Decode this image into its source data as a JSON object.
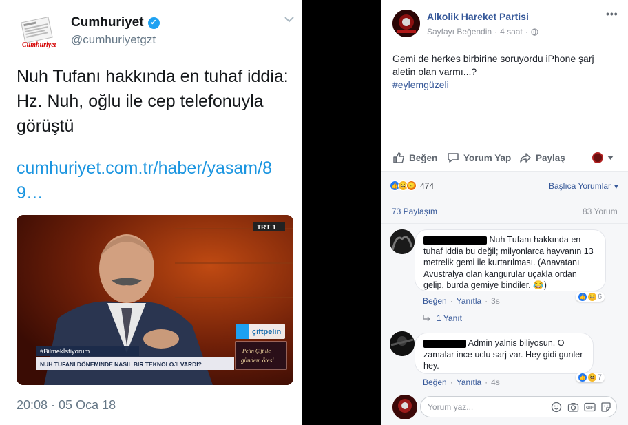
{
  "tweet": {
    "logo_text": "Cumhuriyet",
    "name": "Cumhuriyet",
    "handle": "@cumhuriyetgzt",
    "text": "Nuh Tufanı hakkında en tuhaf iddia: Hz. Nuh, oğlu ile cep telefonuyla görüştü",
    "link": "cumhuriyet.com.tr/haber/yasam/89…",
    "media": {
      "channel": "TRT 1",
      "hashtag": "#Bilmekİstiyorum",
      "twitter_handle": "çiftpelin",
      "lower_third": "NUH TUFANI DÖNEMINDE NASIL BIR TEKNOLOJI VARDI?",
      "program_logo_line1": "Pelin Çift ile",
      "program_logo_line2": "gündem ötesi"
    },
    "timestamp": "20:08 · 05 Oca 18"
  },
  "fb": {
    "page_name": "Alkolik Hareket Partisi",
    "meta_liked": "Sayfayı Beğendin",
    "meta_time": "4 saat",
    "post_text": "Gemi de herkes birbirine soruyordu iPhone şarj aletin olan varmı...?",
    "post_hashtag": "#eylemgüzeli",
    "actions": {
      "like": "Beğen",
      "comment": "Yorum Yap",
      "share": "Paylaş"
    },
    "reaction_count": "474",
    "relevance": "Başlıca Yorumlar",
    "shares": "73 Paylaşım",
    "comment_count": "83 Yorum",
    "comments": [
      {
        "text": "Nuh Tufanı hakkında en tuhaf iddia bu değil; milyonlarca hayvanın 13 metrelik gemi ile kurtarılması. (Anavatanı Avustralya olan kangurular uçakla ordan gelip, burda gemiye bindiler. 😂)",
        "like": "Beğen",
        "reply": "Yanıtla",
        "time": "3s",
        "reactions": "6",
        "replies": "1 Yanıt"
      },
      {
        "text": "Admin yalnis biliyosun. O zamalar ince uclu sarj var. Hey gidi gunler hey.",
        "like": "Beğen",
        "reply": "Yanıtla",
        "time": "4s",
        "reactions": "7"
      }
    ],
    "composer_placeholder": "Yorum yaz...",
    "composer_gif": "GIF",
    "colors": {
      "link": "#365899",
      "like_blue": "#2078f4",
      "haha_yellow": "#f7b928",
      "angry_orange": "#e9710f"
    }
  }
}
